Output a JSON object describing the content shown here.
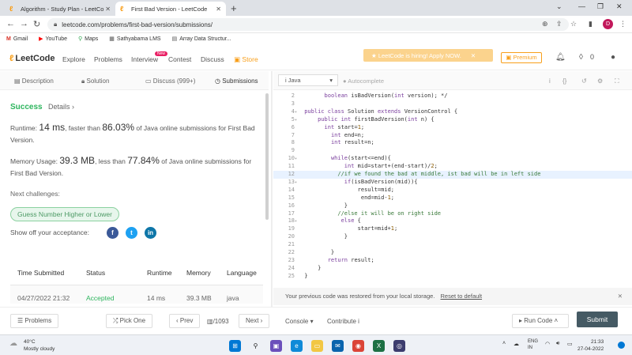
{
  "browser": {
    "tabs": [
      {
        "label": "Algorithm - Study Plan - LeetCo"
      },
      {
        "label": "First Bad Version - LeetCode"
      }
    ],
    "url": "leetcode.com/problems/first-bad-version/submissions/",
    "bookmarks": [
      "Gmail",
      "YouTube",
      "Maps",
      "Sathyabama LMS",
      "Array Data Structur..."
    ],
    "profile_initial": "D"
  },
  "nav": {
    "logo": "LeetCode",
    "links": [
      "Explore",
      "Problems",
      "Interview",
      "Contest",
      "Discuss",
      "Store"
    ],
    "new_badge": "New",
    "hiring_banner": "LeetCode is hiring! Apply NOW.",
    "premium": "Premium",
    "coins": "0"
  },
  "left_tabs": [
    "Description",
    "Solution",
    "Discuss (999+)",
    "Submissions"
  ],
  "result": {
    "status": "Success",
    "details": "Details",
    "runtime_label": "Runtime:",
    "runtime_value": "14 ms",
    "runtime_text": ", faster than",
    "runtime_pct": "86.03%",
    "runtime_suffix": "of Java online submissions for First Bad Version.",
    "memory_label": "Memory Usage:",
    "memory_value": "39.3 MB",
    "memory_text": ", less than",
    "memory_pct": "77.84%",
    "memory_suffix": "of Java online submissions for First Bad Version.",
    "next_label": "Next challenges:",
    "next_challenge": "Guess Number Higher or Lower",
    "showoff": "Show off your acceptance:"
  },
  "submissions": {
    "headers": [
      "Time Submitted",
      "Status",
      "Runtime",
      "Memory",
      "Language"
    ],
    "rows": [
      {
        "time": "04/27/2022 21:32",
        "status": "Accepted",
        "runtime": "14 ms",
        "memory": "39.3 MB",
        "language": "java"
      }
    ]
  },
  "editor": {
    "language": "Java",
    "autocomplete": "Autocomplete",
    "lines": [
      {
        "n": "2",
        "fold": "",
        "text": "      boolean isBadVersion(int version); */"
      },
      {
        "n": "3",
        "fold": "",
        "text": ""
      },
      {
        "n": "4",
        "fold": "▾",
        "text": "public class Solution extends VersionControl {"
      },
      {
        "n": "5",
        "fold": "▾",
        "text": "    public int firstBadVersion(int n) {"
      },
      {
        "n": "6",
        "fold": "",
        "text": "      int start=1;"
      },
      {
        "n": "7",
        "fold": "",
        "text": "        int end=n;"
      },
      {
        "n": "8",
        "fold": "",
        "text": "        int result=n;"
      },
      {
        "n": "9",
        "fold": "",
        "text": ""
      },
      {
        "n": "10",
        "fold": "▾",
        "text": "        while(start<=end){"
      },
      {
        "n": "11",
        "fold": "",
        "text": "            int mid=start+(end-start)/2;"
      },
      {
        "n": "12",
        "fold": "",
        "text": "          //if we found the bad at middle, ist bad will be in left side"
      },
      {
        "n": "13",
        "fold": "▾",
        "text": "            if(isBadVersion(mid)){"
      },
      {
        "n": "14",
        "fold": "",
        "text": "                result=mid;"
      },
      {
        "n": "15",
        "fold": "",
        "text": "                 end=mid-1;"
      },
      {
        "n": "16",
        "fold": "",
        "text": "            }"
      },
      {
        "n": "17",
        "fold": "",
        "text": "          //else it will be on right side"
      },
      {
        "n": "18",
        "fold": "▾",
        "text": "           else {"
      },
      {
        "n": "19",
        "fold": "",
        "text": "                start=mid+1;"
      },
      {
        "n": "20",
        "fold": "",
        "text": "            }"
      },
      {
        "n": "21",
        "fold": "",
        "text": ""
      },
      {
        "n": "22",
        "fold": "",
        "text": "        }"
      },
      {
        "n": "23",
        "fold": "",
        "text": "       return result;"
      },
      {
        "n": "24",
        "fold": "",
        "text": "    }"
      },
      {
        "n": "25",
        "fold": "",
        "text": "}"
      }
    ],
    "restore_msg": "Your previous code was restored from your local storage.",
    "reset_link": "Reset to default"
  },
  "bottom": {
    "problems": "Problems",
    "pick_one": "Pick One",
    "prev": "Prev",
    "page": "/1093",
    "next": "Next",
    "console": "Console",
    "contribute": "Contribute",
    "run_code": "Run Code",
    "submit": "Submit"
  },
  "taskbar": {
    "temp": "40°C",
    "weather": "Mostly cloudy",
    "lang1": "ENG",
    "lang2": "IN",
    "time": "21:33",
    "date": "27-04-2022"
  },
  "colors": {
    "accent": "#f89f1b",
    "success": "#2db55d",
    "submit": "#455a64"
  }
}
